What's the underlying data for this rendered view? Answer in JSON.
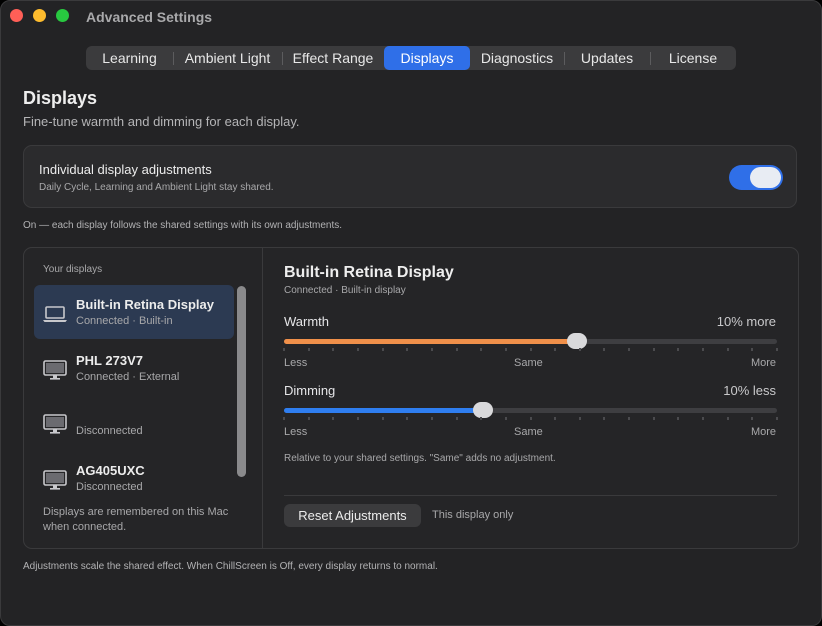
{
  "window": {
    "title": "Advanced Settings"
  },
  "tabs": [
    {
      "label": "Learning",
      "active": false
    },
    {
      "label": "Ambient Light",
      "active": false
    },
    {
      "label": "Effect Range",
      "active": false
    },
    {
      "label": "Displays",
      "active": true
    },
    {
      "label": "Diagnostics",
      "active": false
    },
    {
      "label": "Updates",
      "active": false
    },
    {
      "label": "License",
      "active": false
    }
  ],
  "page": {
    "title": "Displays",
    "subtitle": "Fine-tune warmth and dimming for each display."
  },
  "individual": {
    "title": "Individual display adjustments",
    "subtitle": "Daily Cycle, Learning and Ambient Light stay shared.",
    "enabled": true,
    "note": "On — each display follows the shared settings with its own adjustments."
  },
  "displays_list": {
    "header": "Your displays",
    "items": [
      {
        "name": "Built-in Retina Display",
        "status": "Connected · Built-in",
        "icon": "laptop-icon",
        "selected": true
      },
      {
        "name": "PHL 273V7",
        "status": "Connected · External",
        "icon": "monitor-icon",
        "selected": false
      },
      {
        "name": "",
        "status": "Disconnected",
        "icon": "monitor-icon",
        "selected": false
      },
      {
        "name": "AG405UXC",
        "status": "Disconnected",
        "icon": "monitor-icon",
        "selected": false
      }
    ],
    "remembered_note": "Displays are remembered on this Mac when connected."
  },
  "detail": {
    "title": "Built-in Retina Display",
    "subtitle": "Connected · Built-in display",
    "warmth": {
      "label": "Warmth",
      "value_text": "10% more",
      "position": 0.595,
      "color": "#f0904a"
    },
    "dimming": {
      "label": "Dimming",
      "value_text": "10% less",
      "position": 0.403,
      "color": "#2f7ef0"
    },
    "scale": {
      "left": "Less",
      "mid": "Same",
      "right": "More"
    },
    "relative_note": "Relative to your shared settings. \"Same\" adds no adjustment.",
    "reset_label": "Reset Adjustments",
    "reset_scope": "This display only"
  },
  "footer": "Adjustments scale the shared effect. When ChillScreen is Off, every display returns to normal.",
  "colors": {
    "accent": "#2f6fe8",
    "warmth": "#f0904a",
    "dimming": "#2f7ef0"
  }
}
